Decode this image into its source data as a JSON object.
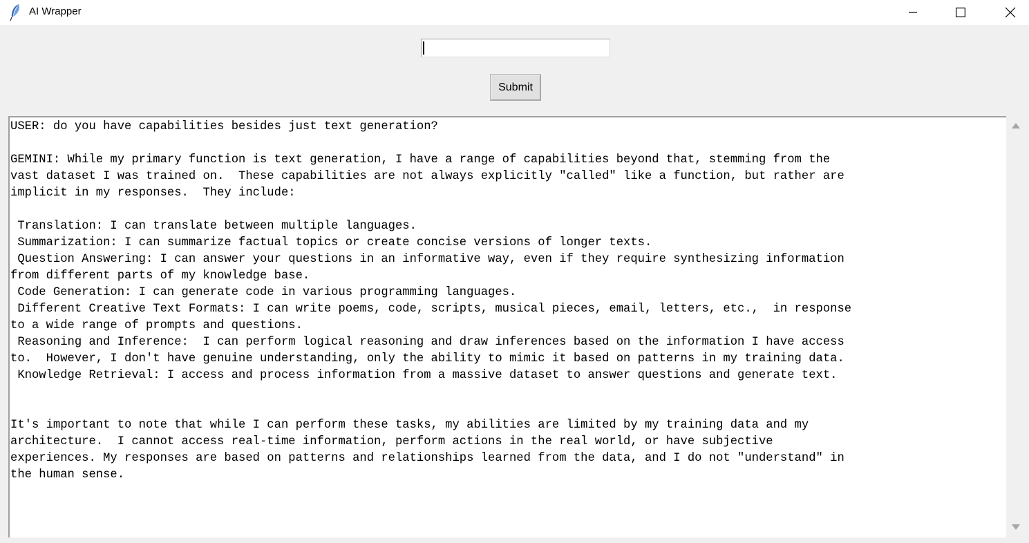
{
  "window": {
    "title": "AI Wrapper",
    "icon": "feather-icon",
    "controls": [
      "minimize-icon",
      "maximize-icon",
      "close-icon"
    ]
  },
  "prompt": {
    "value": "",
    "placeholder": ""
  },
  "submit": {
    "label": "Submit"
  },
  "output": {
    "text": "USER: do you have capabilities besides just text generation?\n\nGEMINI: While my primary function is text generation, I have a range of capabilities beyond that, stemming from the\nvast dataset I was trained on.  These capabilities are not always explicitly \"called\" like a function, but rather are\nimplicit in my responses.  They include:\n\n Translation: I can translate between multiple languages.\n Summarization: I can summarize factual topics or create concise versions of longer texts.\n Question Answering: I can answer your questions in an informative way, even if they require synthesizing information\nfrom different parts of my knowledge base.\n Code Generation: I can generate code in various programming languages.\n Different Creative Text Formats: I can write poems, code, scripts, musical pieces, email, letters, etc.,  in response\nto a wide range of prompts and questions.\n Reasoning and Inference:  I can perform logical reasoning and draw inferences based on the information I have access\nto.  However, I don't have genuine understanding, only the ability to mimic it based on patterns in my training data.\n Knowledge Retrieval: I access and process information from a massive dataset to answer questions and generate text.\n\n\nIt's important to note that while I can perform these tasks, my abilities are limited by my training data and my\narchitecture.  I cannot access real-time information, perform actions in the real world, or have subjective\nexperiences. My responses are based on patterns and relationships learned from the data, and I do not \"understand\" in\nthe human sense."
  },
  "scrollbar": {
    "up_icon": "scroll-up-arrow-icon",
    "down_icon": "scroll-down-arrow-icon"
  }
}
